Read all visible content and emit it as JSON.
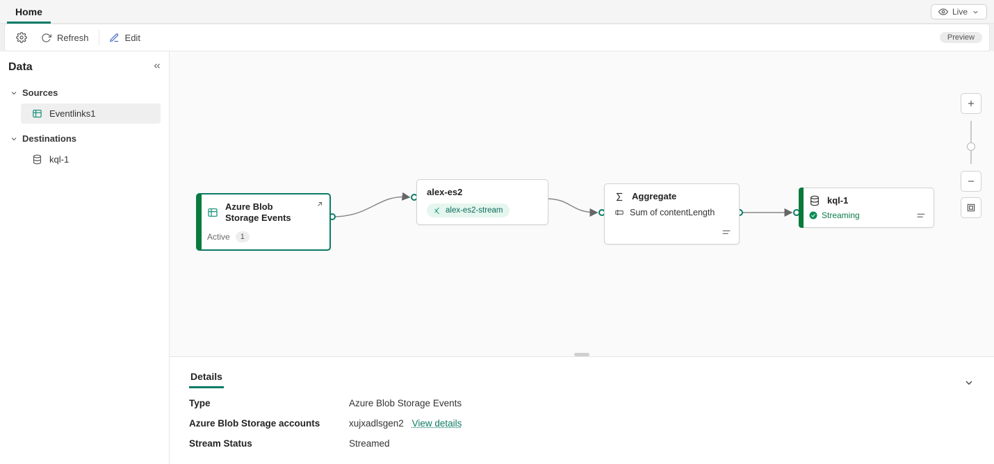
{
  "tabs": {
    "home": "Home"
  },
  "live_label": "Live",
  "toolbar": {
    "refresh": "Refresh",
    "edit": "Edit",
    "preview": "Preview"
  },
  "sidebar": {
    "title": "Data",
    "groups": {
      "sources": {
        "label": "Sources",
        "items": [
          {
            "label": "Eventlinks1"
          }
        ]
      },
      "destinations": {
        "label": "Destinations",
        "items": [
          {
            "label": "kql-1"
          }
        ]
      }
    }
  },
  "nodes": {
    "source": {
      "title": "Azure Blob Storage Events",
      "status_label": "Active",
      "badge": "1"
    },
    "stream": {
      "title": "alex-es2",
      "chip": "alex-es2-stream"
    },
    "aggregate": {
      "title": "Aggregate",
      "detail": "Sum of contentLength"
    },
    "dest": {
      "title": "kql-1",
      "status": "Streaming"
    }
  },
  "details": {
    "tab": "Details",
    "rows": {
      "type": {
        "label": "Type",
        "value": "Azure Blob Storage Events"
      },
      "acct": {
        "label": "Azure Blob Storage accounts",
        "value": "xujxadlsgen2",
        "link_label": "View details"
      },
      "status": {
        "label": "Stream Status",
        "value": "Streamed"
      }
    }
  }
}
